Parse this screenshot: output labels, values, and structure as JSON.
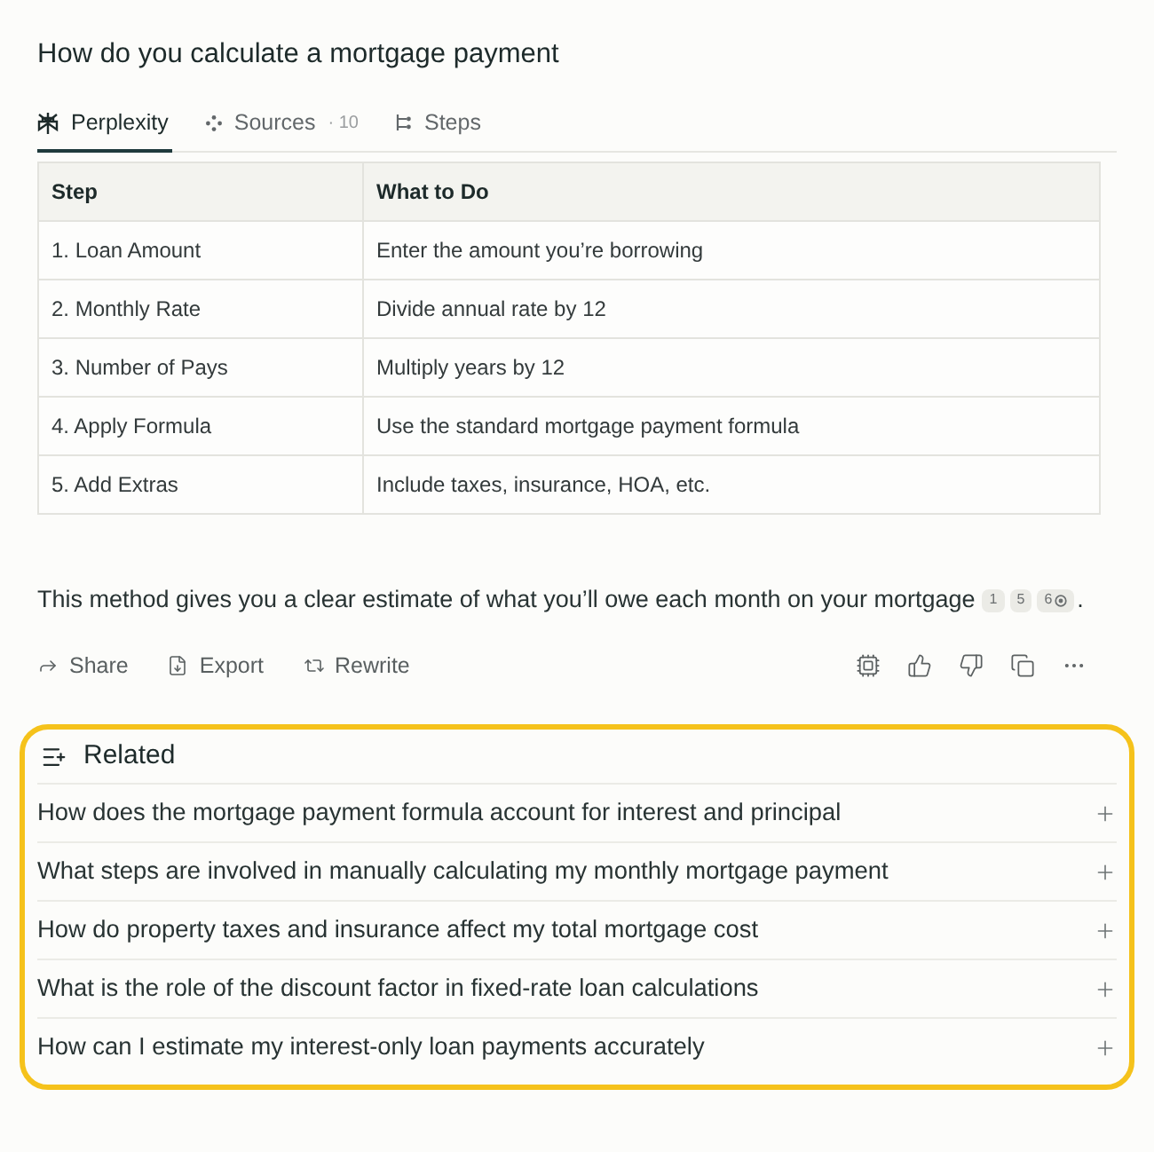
{
  "question": {
    "title": "How do you calculate a mortgage payment"
  },
  "tabs": [
    {
      "kind": "answer",
      "label": "Perplexity",
      "selected": true
    },
    {
      "kind": "sources",
      "label": "Sources",
      "count": "· 10",
      "selected": false
    },
    {
      "kind": "steps",
      "label": "Steps",
      "selected": false
    }
  ],
  "table": {
    "columns": [
      "Step",
      "What to Do"
    ],
    "rows": [
      [
        "1. Loan Amount",
        "Enter the amount you’re borrowing"
      ],
      [
        "2. Monthly Rate",
        "Divide annual rate by 12"
      ],
      [
        "3. Number of Pays",
        "Multiply years by 12"
      ],
      [
        "4. Apply Formula",
        "Use the standard mortgage payment formula"
      ],
      [
        "5. Add Extras",
        "Include taxes, insurance, HOA, etc."
      ]
    ]
  },
  "answer": {
    "text": "This method gives you a clear estimate of what you’ll owe each month on your mortgage",
    "citations": [
      {
        "kind": "single",
        "label": "1"
      },
      {
        "kind": "single",
        "label": "5"
      },
      {
        "kind": "group",
        "label": "6"
      }
    ],
    "end": "."
  },
  "actions": [
    {
      "kind": "share",
      "label": "Share"
    },
    {
      "kind": "export",
      "label": "Export"
    },
    {
      "kind": "rewrite",
      "label": "Rewrite"
    }
  ],
  "related": {
    "title": "Related",
    "highlighted": true,
    "items": [
      "How does the mortgage payment formula account for interest and principal",
      "What steps are involved in manually calculating my monthly mortgage payment",
      "How do property taxes and insurance affect my total mortgage cost",
      "What is the role of the discount factor in fixed-rate loan calculations",
      "How can I estimate my interest-only loan payments accurately"
    ]
  }
}
